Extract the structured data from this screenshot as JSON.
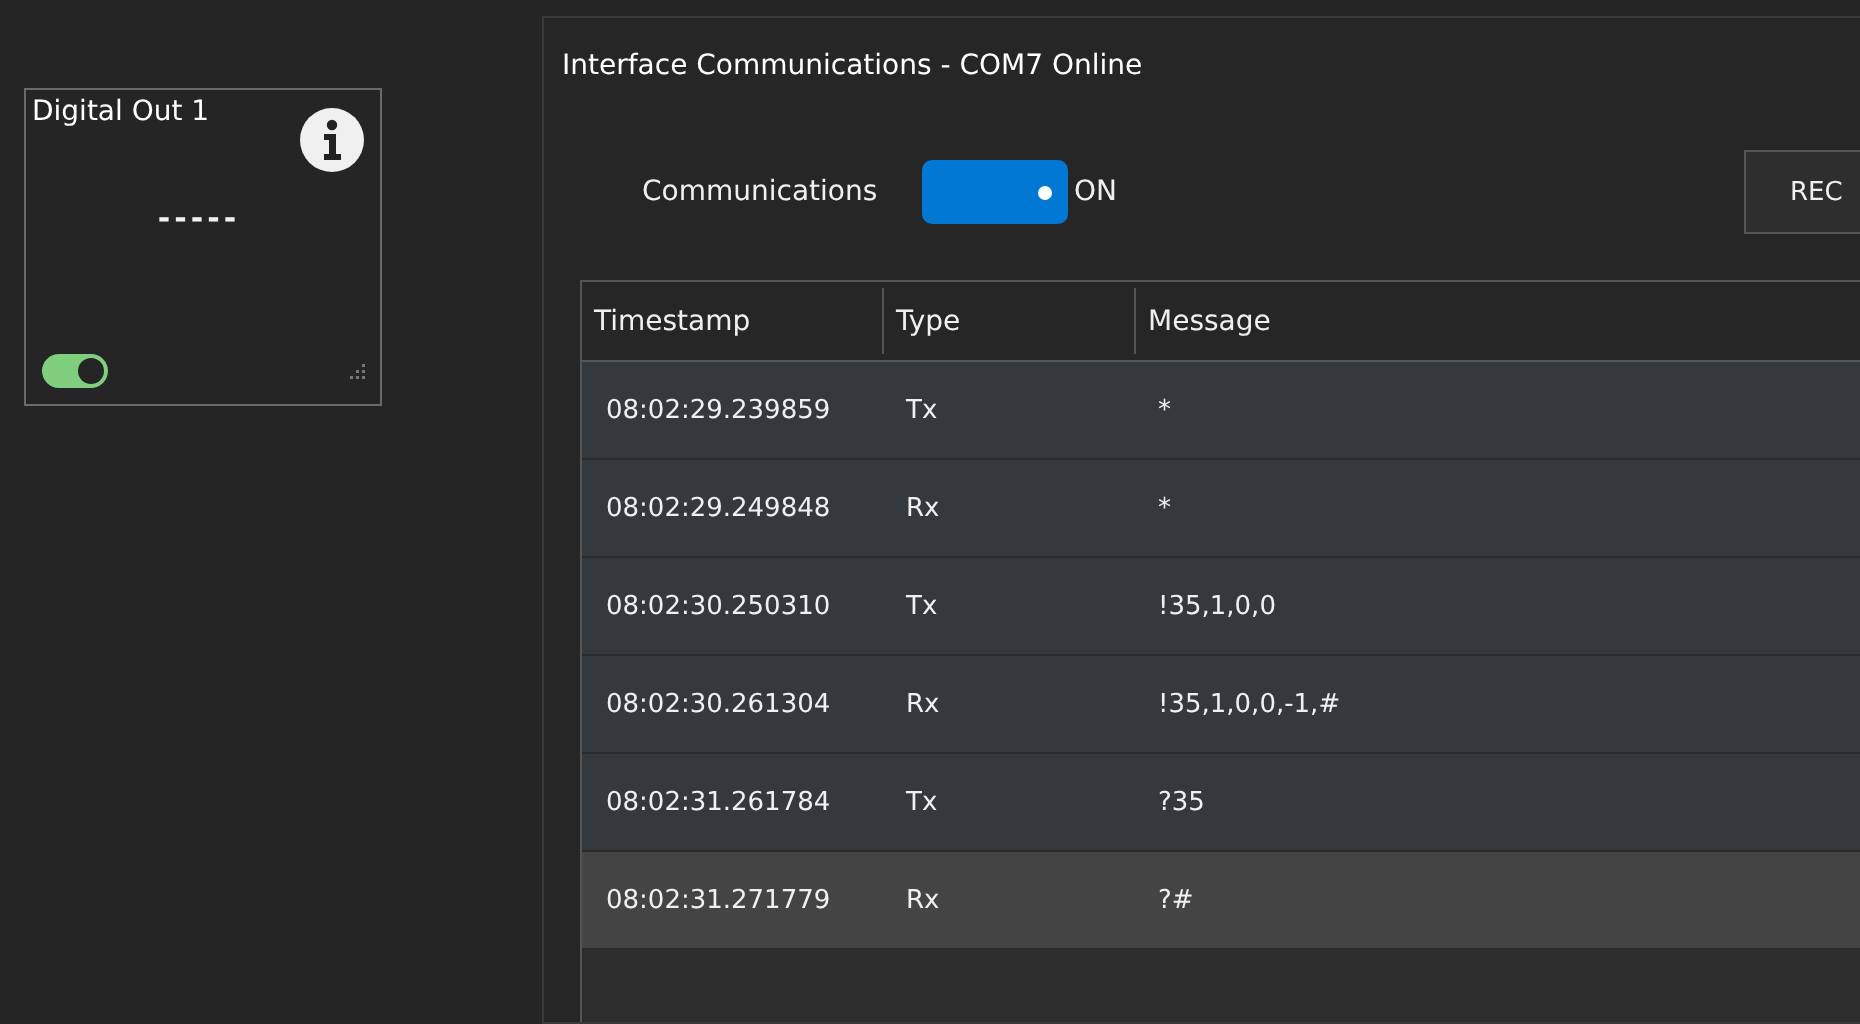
{
  "card": {
    "title": "Digital Out 1",
    "value": "-----",
    "toggle_on": true
  },
  "dialog": {
    "title": "Interface Communications - COM7 Online",
    "comm_label": "Communications",
    "comm_on": true,
    "comm_state": "ON",
    "button": "REC",
    "columns": [
      "Timestamp",
      "Type",
      "Message"
    ],
    "rows": [
      {
        "cells": [
          "08:02:29.239859",
          "Tx",
          "*"
        ],
        "selected": false
      },
      {
        "cells": [
          "08:02:29.249848",
          "Rx",
          "*"
        ],
        "selected": false
      },
      {
        "cells": [
          "08:02:30.250310",
          "Tx",
          "!35,1,0,0"
        ],
        "selected": false
      },
      {
        "cells": [
          "08:02:30.261304",
          "Rx",
          "!35,1,0,0,-1,#"
        ],
        "selected": false
      },
      {
        "cells": [
          "08:02:31.261784",
          "Tx",
          "?35"
        ],
        "selected": false
      },
      {
        "cells": [
          "08:02:31.271779",
          "Rx",
          "?#"
        ],
        "selected": true
      }
    ]
  }
}
